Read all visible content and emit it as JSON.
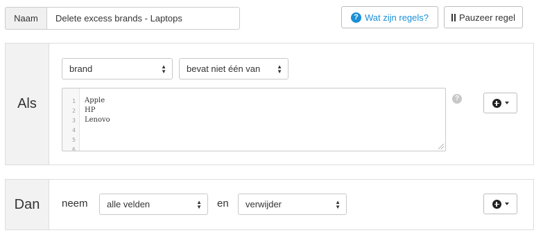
{
  "top": {
    "name_label": "Naam",
    "name_value": "Delete excess brands - Laptops",
    "help_button": "Wat zijn regels?",
    "pause_button": "Pauzeer regel"
  },
  "als": {
    "label": "Als",
    "field_select": "brand",
    "operator_select": "bevat niet één van",
    "editor": {
      "line_numbers": [
        "1",
        "2",
        "3",
        "4",
        "5",
        "6"
      ],
      "lines": [
        "Apple",
        "HP",
        "Lenovo",
        "",
        "",
        ""
      ]
    },
    "help_icon": "?"
  },
  "dan": {
    "label": "Dan",
    "word_take": "neem",
    "fields_select": "alle velden",
    "word_and": "en",
    "action_select": "verwijder"
  },
  "icons": {
    "help": "question-circle-icon",
    "pause": "pause-icon",
    "add": "plus-circle-icon",
    "caret": "caret-down-icon",
    "select_arrows": "up-down-arrows-icon"
  },
  "colors": {
    "link_blue": "#1a8fd6",
    "panel_label_bg": "#f2f2f2",
    "border": "#dddddd"
  }
}
